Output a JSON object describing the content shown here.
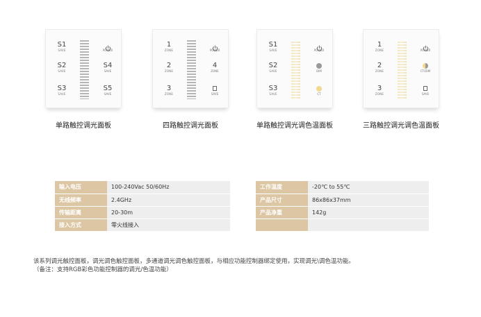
{
  "panels": [
    {
      "caption": "单路触控调光面板",
      "left_keys": [
        {
          "main": "S1",
          "sub": "SAVE"
        },
        {
          "main": "S2",
          "sub": "SAVE"
        },
        {
          "main": "S3",
          "sub": "SAVE"
        }
      ],
      "right_keys": [
        {
          "type": "power",
          "sub": "POWER"
        },
        {
          "type": "text",
          "main": "S4",
          "sub": "SAVE"
        },
        {
          "type": "text",
          "main": "S5",
          "sub": "SAVE"
        }
      ],
      "bar_color": "#b4b4b4"
    },
    {
      "caption": "四路触控调光面板",
      "left_keys": [
        {
          "main": "1",
          "sub": "ZONE"
        },
        {
          "main": "2",
          "sub": "ZONE"
        },
        {
          "main": "3",
          "sub": "ZONE"
        }
      ],
      "right_keys": [
        {
          "type": "power",
          "sub": "POWER"
        },
        {
          "type": "text",
          "main": "4",
          "sub": "ZONE"
        },
        {
          "type": "save",
          "sub": "SAVE"
        }
      ],
      "bar_color": "#b4b4b4"
    },
    {
      "caption": "单路触控调光调色温面板",
      "left_keys": [
        {
          "main": "S1",
          "sub": "SAVE"
        },
        {
          "main": "S2",
          "sub": "SAVE"
        },
        {
          "main": "S3",
          "sub": "SAVE"
        }
      ],
      "right_keys": [
        {
          "type": "power",
          "sub": "POWER"
        },
        {
          "type": "dot",
          "sub": "DIM",
          "color": "#9a9a9a"
        },
        {
          "type": "dot",
          "sub": "CT",
          "color": "#f1d98f"
        }
      ],
      "bar_color": "#f2e4bd"
    },
    {
      "caption": "三路触控调光调色温面板",
      "left_keys": [
        {
          "main": "1",
          "sub": "ZONE"
        },
        {
          "main": "2",
          "sub": "ZONE"
        },
        {
          "main": "3",
          "sub": "ZONE"
        }
      ],
      "right_keys": [
        {
          "type": "power",
          "sub": "POWER"
        },
        {
          "type": "halfdot",
          "sub": "CT/DIM"
        },
        {
          "type": "save",
          "sub": "SAVE"
        }
      ],
      "bar_color": "#f2e4bd"
    }
  ],
  "specs_left": [
    {
      "key": "输入电压",
      "value": "100-240Vac  50/60Hz"
    },
    {
      "key": "无线频率",
      "value": "2.4GHz"
    },
    {
      "key": "传输距离",
      "value": "20-30m"
    },
    {
      "key": "接入方式",
      "value": "零火线接入"
    }
  ],
  "specs_right": [
    {
      "key": "工作温度",
      "value": "-20℃ to 55℃"
    },
    {
      "key": "产品尺寸",
      "value": "86x86x37mm"
    },
    {
      "key": "产品净重",
      "value": "142g"
    },
    {
      "key": "",
      "value": ""
    }
  ],
  "description": {
    "line1": "该系列调光触控面板，调光调色触控面板，多通道调光调色触控面板，与相应功能控制器绑定使用，实现调光\\调色温功能。",
    "line2": "（备注：支持RGB彩色功能控制器的调光/色温功能）"
  },
  "colors": {
    "spec_key_bg": "#dcc6a3",
    "spec_value_bg": "#eeeeee",
    "panel_bg": "#fbfbfb"
  }
}
